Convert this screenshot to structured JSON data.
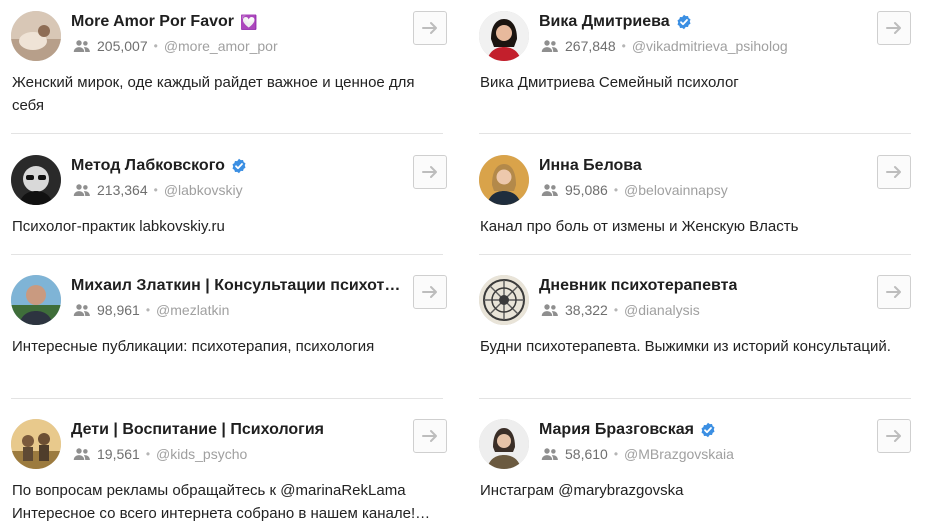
{
  "colors": {
    "accent": "#3b8fe3",
    "divider": "#e3e3e3",
    "muted": "#8f8f8f"
  },
  "icons": {
    "subscribers": "people-icon",
    "open": "arrow-right-icon",
    "verified": "verified-badge-icon"
  },
  "channels": [
    {
      "title": "More Amor Por Favor",
      "emoji": "💟",
      "verified": false,
      "subscribers": "205,007",
      "handle": "@more_amor_por",
      "description": "Женский мирок, оде каждый райдет важное и ценное для себя"
    },
    {
      "title": "Вика Дмитриева",
      "verified": true,
      "subscribers": "267,848",
      "handle": "@vikadmitrieva_psiholog",
      "description": "Вика Дмитриева Семейный психолог"
    },
    {
      "title": "Метод Лабковского",
      "verified": true,
      "subscribers": "213,364",
      "handle": "@labkovskiy",
      "description": "Психолог-практик labkovskiy.ru"
    },
    {
      "title": "Инна Белова",
      "verified": false,
      "subscribers": "95,086",
      "handle": "@belovainnapsy",
      "description": "Канал про боль от измены и Женскую Власть"
    },
    {
      "title": "Михаил Златкин | Консультации психот…",
      "verified": false,
      "subscribers": "98,961",
      "handle": "@mezlatkin",
      "description": "Интересные публикации: психотерапия, психология"
    },
    {
      "title": "Дневник психотерапевта",
      "verified": false,
      "subscribers": "38,322",
      "handle": "@dianalysis",
      "description": "Будни психотерапевта. Выжимки из историй консультаций."
    },
    {
      "title": "Дети | Воспитание | Психология",
      "verified": false,
      "subscribers": "19,561",
      "handle": "@kids_psycho",
      "description": "По вопросам рекламы обращайтесь к @marinaRekLama Интересное со всего интернета собрано в нашем канале!…"
    },
    {
      "title": "Мария Бразговская",
      "verified": true,
      "subscribers": "58,610",
      "handle": "@MBrazgovskaia",
      "description": "Инстаграм @marybrazgovska"
    }
  ]
}
